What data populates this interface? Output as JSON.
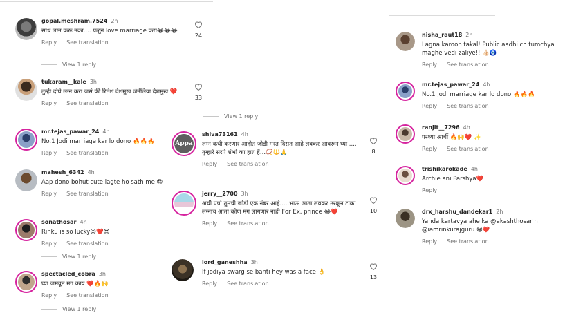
{
  "actions": {
    "reply": "Reply",
    "translate": "See translation",
    "view_reply": "View 1 reply"
  },
  "left": [
    {
      "user": "gopal.meshram.7524",
      "time": "2h",
      "text": "साधं लग्न करू नका.... पळून love marriage करा😂😂😂",
      "likes": "24"
    },
    {
      "user": "tukaram__kale",
      "time": "3h",
      "text": "तुम्ही दोघे लग्न करा जसं की रितेश देशमुख जेनेलिया देशमुख ❤️",
      "likes": "33"
    },
    {
      "user": "mr.tejas_pawar_24",
      "time": "4h",
      "text": "No.1 Jodi  marriage kar lo dono 🔥🔥🔥",
      "likes": ""
    },
    {
      "user": "mahesh_6342",
      "time": "4h",
      "text": "Aap dono bohut cute lagte ho sath me 😍💞",
      "likes": ""
    },
    {
      "user": "sonathosar",
      "time": "4h",
      "text": "Rinku is so lucky😉❤️😍",
      "likes": ""
    },
    {
      "user": "spectacled_cobra",
      "time": "3h",
      "text": "घ्या जमवून मग काय ❤️🔥🙌",
      "likes": ""
    }
  ],
  "middle": [
    {
      "user": "shiva73161",
      "time": "4h",
      "avatar_text": "Appa",
      "text": "लग्न कधी करणार आहोत जोडी मस्त दिसत आहे  लवकर आवरून घ्या .... तुम्हारे सरपे शंभो का हात हैं...📿🔱🙏",
      "likes": "8"
    },
    {
      "user": "jerry__2700",
      "time": "3h",
      "text": "अर्ची पर्षा तुमची जोडी एक नंबर आहे.....भाऊ आता लवकर उरकून टाका लग्नाचं आता कोण मग लागणार नाही  For Ex. prince 😂❤️",
      "likes": "10"
    },
    {
      "user": "lord_ganeshha",
      "time": "3h",
      "text": "If jodiya swarg se banti hey was a face 👌",
      "likes": "13"
    }
  ],
  "right": [
    {
      "user": "nisha_raut18",
      "time": "2h",
      "text": "Lagna karoon takal! Public aadhi ch tumchya maghe vedi zaliye!! 👍🏻🧿"
    },
    {
      "user": "mr.tejas_pawar_24",
      "time": "4h",
      "text": "No.1 Jodi  marriage kar lo dono 🔥🔥🔥"
    },
    {
      "user": "ranjit__7296",
      "time": "4h",
      "text": "परश्या आर्ची 🔥🙌❤️ ✨"
    },
    {
      "user": "trishikarokade",
      "time": "4h",
      "text": "Archie ani Parshya❤️"
    },
    {
      "user": "drx_harshu_dandekar1",
      "time": "2h",
      "text": "Yanda kartavya ahe ka @akashthosar n @iamrinkurajguru 😁❤️"
    }
  ],
  "colors": {
    "story_ring": "#d6249f",
    "meta_gray": "#737373",
    "mention": "#00376b"
  }
}
